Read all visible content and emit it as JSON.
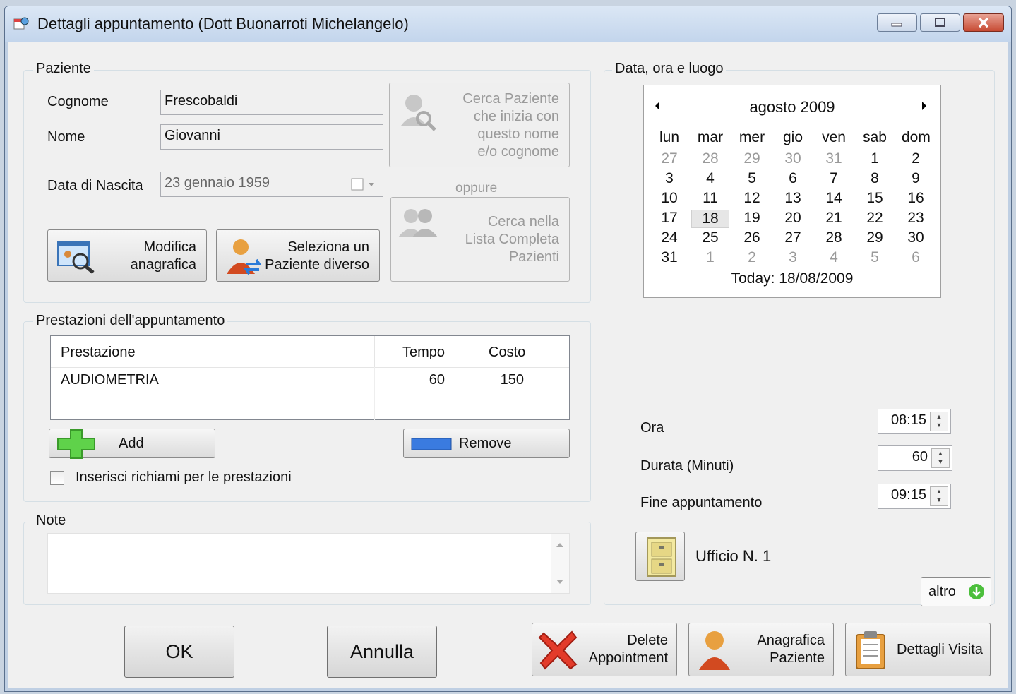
{
  "window": {
    "title": "Dettagli appuntamento (Dott Buonarroti Michelangelo)"
  },
  "paziente": {
    "legend": "Paziente",
    "cognome_label": "Cognome",
    "cognome_value": "Frescobaldi",
    "nome_label": "Nome",
    "nome_value": "Giovanni",
    "nascita_label": "Data di Nascita",
    "nascita_value": "23  gennaio   1959",
    "cerca_nome_line1": "Cerca Paziente",
    "cerca_nome_line2": "che inizia con",
    "cerca_nome_line3": "questo nome",
    "cerca_nome_line4": "e/o cognome",
    "oppure": "oppure",
    "cerca_lista_line1": "Cerca nella",
    "cerca_lista_line2": "Lista Completa",
    "cerca_lista_line3": "Pazienti",
    "modifica_line1": "Modifica",
    "modifica_line2": "anagrafica",
    "seleziona_line1": "Seleziona un",
    "seleziona_line2": "Paziente diverso"
  },
  "prestazioni": {
    "legend": "Prestazioni dell'appuntamento",
    "columns": [
      "Prestazione",
      "Tempo",
      "Costo"
    ],
    "rows": [
      [
        "AUDIOMETRIA",
        "60",
        "150"
      ]
    ],
    "add_label": "Add",
    "remove_label": "Remove",
    "richiami_label": "Inserisci richiami per le prestazioni",
    "richiami_checked": false
  },
  "note": {
    "legend": "Note",
    "value": ""
  },
  "data": {
    "legend": "Data, ora e luogo",
    "calendar": {
      "month_label": "agosto 2009",
      "weekdays": [
        "lun",
        "mar",
        "mer",
        "gio",
        "ven",
        "sab",
        "dom"
      ],
      "weeks": [
        [
          "27",
          "28",
          "29",
          "30",
          "31",
          "1",
          "2"
        ],
        [
          "3",
          "4",
          "5",
          "6",
          "7",
          "8",
          "9"
        ],
        [
          "10",
          "11",
          "12",
          "13",
          "14",
          "15",
          "16"
        ],
        [
          "17",
          "18",
          "19",
          "20",
          "21",
          "22",
          "23"
        ],
        [
          "24",
          "25",
          "26",
          "27",
          "28",
          "29",
          "30"
        ],
        [
          "31",
          "1",
          "2",
          "3",
          "4",
          "5",
          "6"
        ]
      ],
      "selected_day": "18",
      "today_label": "Today: 18/08/2009"
    },
    "ora_label": "Ora",
    "ora_value": "08:15",
    "durata_label": "Durata (Minuti)",
    "durata_value": "60",
    "fine_label": "Fine appuntamento",
    "fine_value": "09:15",
    "ufficio_label": "Ufficio N. 1",
    "altro_label": "altro"
  },
  "footer": {
    "ok_label": "OK",
    "annulla_label": "Annulla",
    "delete_line1": "Delete",
    "delete_line2": "Appointment",
    "anagrafica_line1": "Anagrafica",
    "anagrafica_line2": "Paziente",
    "dettagli_label": "Dettagli Visita"
  },
  "colors": {
    "accent": "#3a8be0",
    "window_frame": "#bfcfe3",
    "close_button": "#c74a33"
  }
}
